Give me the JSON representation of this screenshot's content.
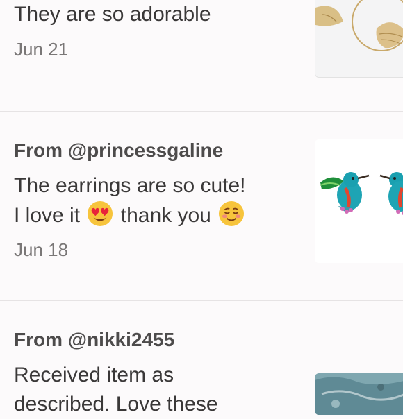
{
  "reviews": [
    {
      "from": "",
      "text_lines": [
        "They are so adorable"
      ],
      "date": "Jun 21",
      "image": "gold-ginkgo-leaf-earrings"
    },
    {
      "from": "From @princessgaline",
      "text_lines": [
        "The earrings are so cute!",
        "I love it",
        "thank you"
      ],
      "emojis": [
        "heart-eyes-emoji",
        "smiling-blush-emoji"
      ],
      "date": "Jun 18",
      "image": "hummingbird-enamel-earrings"
    },
    {
      "from": "From @nikki2455",
      "text_lines": [
        "Received item as",
        "described. Love these"
      ],
      "date": "",
      "image": "stone-jewelry-photo"
    }
  ]
}
